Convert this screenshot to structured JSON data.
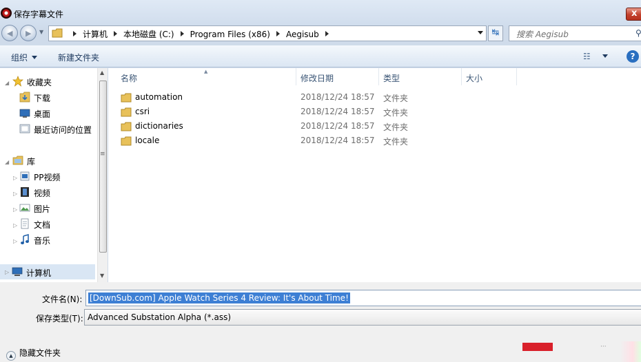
{
  "window": {
    "title": "保存字幕文件",
    "close_label": "x"
  },
  "address_bar": {
    "crumbs": [
      "计算机",
      "本地磁盘 (C:)",
      "Program Files (x86)",
      "Aegisub"
    ],
    "search_placeholder": "搜索 Aegisub"
  },
  "toolbar": {
    "organize": "组织",
    "new_folder": "新建文件夹",
    "help": "?"
  },
  "sidebar": {
    "favorites": {
      "label": "收藏夹",
      "items": [
        "下载",
        "桌面",
        "最近访问的位置"
      ]
    },
    "libraries": {
      "label": "库",
      "items": [
        "PP视频",
        "视频",
        "图片",
        "文档",
        "音乐"
      ]
    },
    "computer": "计算机"
  },
  "columns": {
    "name": "名称",
    "modified": "修改日期",
    "type": "类型",
    "size": "大小"
  },
  "files": [
    {
      "name": "automation",
      "modified": "2018/12/24 18:57",
      "type": "文件夹"
    },
    {
      "name": "csri",
      "modified": "2018/12/24 18:57",
      "type": "文件夹"
    },
    {
      "name": "dictionaries",
      "modified": "2018/12/24 18:57",
      "type": "文件夹"
    },
    {
      "name": "locale",
      "modified": "2018/12/24 18:57",
      "type": "文件夹"
    }
  ],
  "save": {
    "filename_label": "文件名(N):",
    "filename_value": "[DownSub.com] Apple Watch Series 4 Review: It's About Time!",
    "filetype_label": "保存类型(T):",
    "filetype_value": "Advanced Substation Alpha (*.ass)",
    "hide_folders": "隐藏文件夹"
  },
  "colors": {
    "accent": "#3d7fd4",
    "folder": "#e8c15a",
    "close": "#c2402c"
  }
}
